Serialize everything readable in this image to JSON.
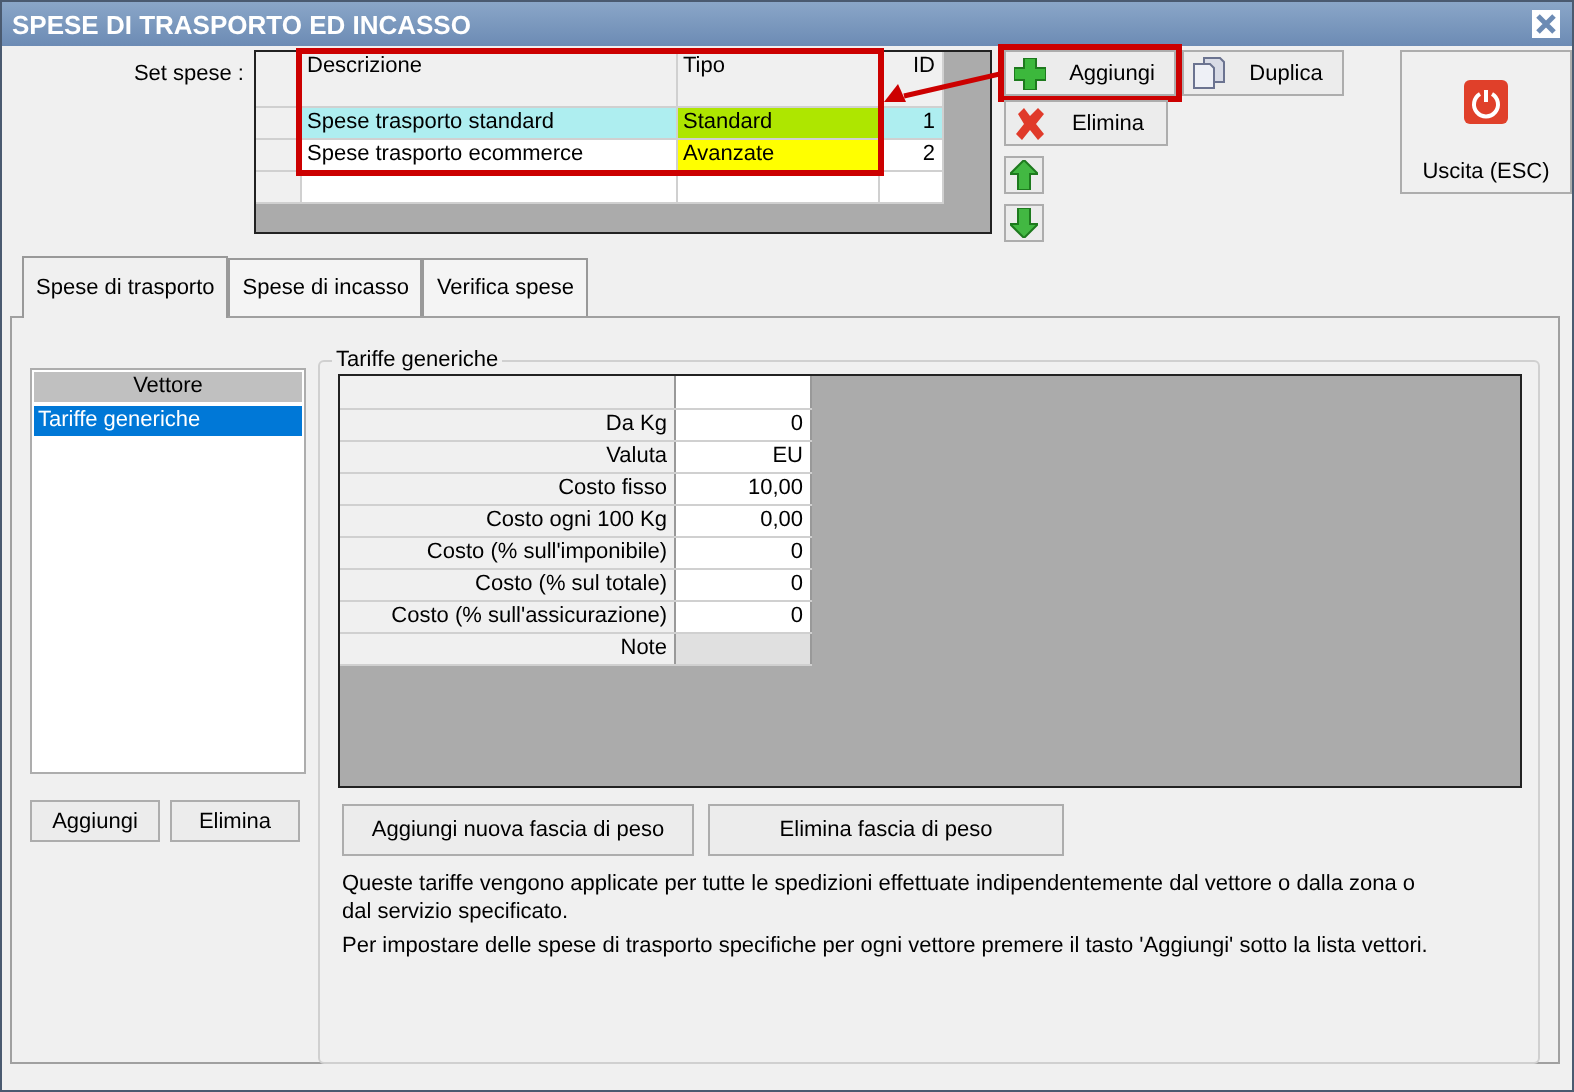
{
  "window": {
    "title": "SPESE DI TRASPORTO ED INCASSO"
  },
  "set_spese": {
    "label": "Set spese :",
    "highlighted": true,
    "columns": [
      "Descrizione",
      "Tipo",
      "ID"
    ],
    "rows": [
      {
        "descrizione": "Spese trasporto standard",
        "tipo": "Standard",
        "color": "#aee600",
        "id": "1",
        "selected": true
      },
      {
        "descrizione": "Spese trasporto ecommerce",
        "tipo": "Avanzate",
        "color": "#ffff00",
        "id": "2",
        "selected": false
      }
    ]
  },
  "set_buttons": [
    {
      "kind": "add",
      "label": "Aggiungi",
      "highlighted": true
    },
    {
      "kind": "duplicate",
      "label": "Duplica"
    },
    {
      "kind": "delete",
      "label": "Elimina"
    },
    {
      "kind": "up"
    },
    {
      "kind": "down"
    }
  ],
  "exit_button": {
    "label": "Uscita (ESC)"
  },
  "tabs": [
    {
      "label": "Spese di trasporto",
      "selected": true
    },
    {
      "label": "Spese di incasso",
      "selected": false
    },
    {
      "label": "Verifica spese",
      "selected": false
    }
  ],
  "vettori": {
    "header": "Vettore",
    "items": [
      {
        "label": "Tariffe generiche",
        "selected": true
      }
    ],
    "buttons": [
      "Aggiungi",
      "Elimina"
    ]
  },
  "tariffe": {
    "title": "Tariffe generiche",
    "rows": [
      {
        "label": "Da Kg",
        "value": "0"
      },
      {
        "label": "Valuta",
        "value": "EU"
      },
      {
        "label": "Costo fisso",
        "value": "10,00"
      },
      {
        "label": "Costo ogni 100 Kg",
        "value": "0,00"
      },
      {
        "label": "Costo (% sull'imponibile)",
        "value": "0"
      },
      {
        "label": "Costo (% sul totale)",
        "value": "0"
      },
      {
        "label": "Costo (% sull'assicurazione)",
        "value": "0"
      },
      {
        "label": "Note"
      }
    ],
    "buttons": [
      "Aggiungi nuova fascia di peso",
      "Elimina fascia di peso"
    ],
    "notes": [
      "Queste tariffe vengono applicate per tutte le spedizioni effettuate indipendentemente dal vettore o dalla zona o dal servizio specificato.",
      "Per impostare delle spese di trasporto specifiche per ogni vettore premere il tasto 'Aggiungi' sotto la lista vettori."
    ]
  }
}
